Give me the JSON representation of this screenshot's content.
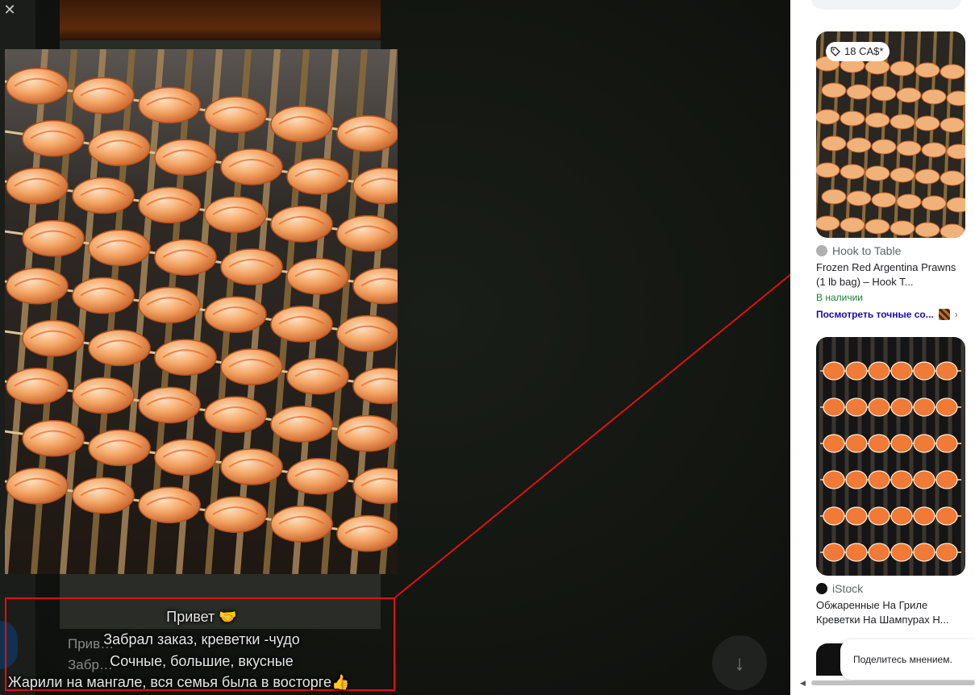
{
  "viewer": {
    "close_glyph": "✕",
    "background_chat_text": "Прив…\nЗабр…",
    "down_glyph": "↓"
  },
  "caption": {
    "lines": [
      "Привет 🤝",
      "Забрал заказ, креветки -чудо",
      "Сочные, большие, вкусные",
      "Жарили на мангале, вся семья была  в восторге👍"
    ]
  },
  "results": [
    {
      "price": "18 CA$*",
      "source": "Hook to Table",
      "title": "Frozen Red Argentina Prawns (1 lb bag) – Hook T...",
      "stock": "В наличии",
      "more": "Посмотреть точные со...",
      "more_chevron": "›"
    },
    {
      "source": "iStock",
      "title": "Обжаренные На Гриле Креветки На Шампурах Н..."
    }
  ],
  "feedback": {
    "label": "Поделитесь мнением."
  },
  "colors": {
    "highlight": "#e01010",
    "stock_green": "#188038",
    "link_blue": "#1a0dab"
  }
}
